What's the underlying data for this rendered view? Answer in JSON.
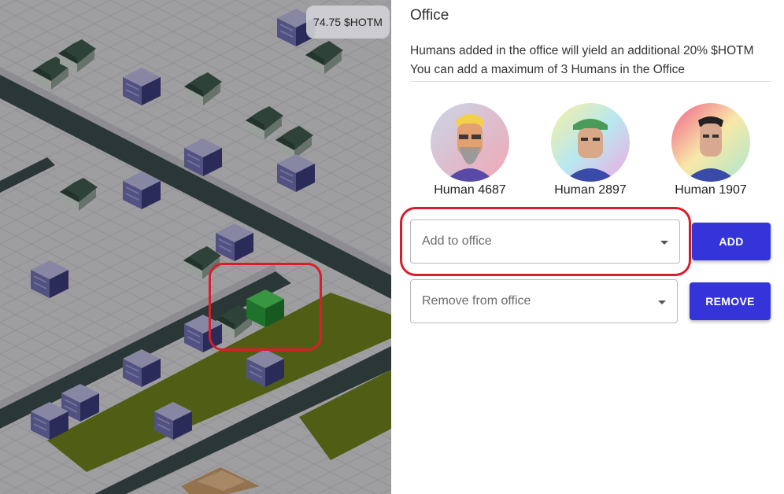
{
  "balance": "74.75 $HOTM",
  "office": {
    "title": "Office",
    "description_line1": "Humans added in the office will yield an additional 20% $HOTM",
    "description_line2": "You can add a maximum of 3 Humans in the Office",
    "humans": [
      {
        "label": "Human 4687",
        "avatar_icon": "bearded-human-avatar-icon"
      },
      {
        "label": "Human 2897",
        "avatar_icon": "capped-human-avatar-icon"
      },
      {
        "label": "Human 1907",
        "avatar_icon": "human-avatar-icon"
      }
    ],
    "add_select_placeholder": "Add to office",
    "add_button": "ADD",
    "remove_select_placeholder": "Remove from office",
    "remove_button": "REMOVE"
  },
  "colors": {
    "accent": "#3434d8",
    "highlight": "#d81e2a",
    "road": "#3a4a4a",
    "park": "#6b7f1c",
    "selected_building": "#2a9a3a"
  }
}
